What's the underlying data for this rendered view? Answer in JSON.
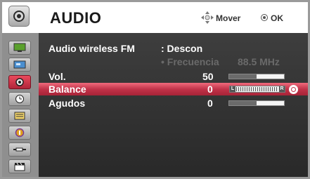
{
  "header": {
    "title": "AUDIO",
    "move_hint": "Mover",
    "ok_hint": "OK",
    "header_icon": "speaker-icon"
  },
  "sidebar": {
    "items": [
      {
        "icon": "picture-icon"
      },
      {
        "icon": "screen-icon"
      },
      {
        "icon": "audio-icon",
        "active": true
      },
      {
        "icon": "clock-icon"
      },
      {
        "icon": "options-icon"
      },
      {
        "icon": "info-icon"
      },
      {
        "icon": "input-icon"
      },
      {
        "icon": "clapper-icon"
      }
    ]
  },
  "menu": {
    "wireless_label": "Audio wireless FM",
    "wireless_value": ": Descon",
    "frequency_label": "• Frecuencia",
    "frequency_value": "88.5 MHz",
    "volume_label": "Vol.",
    "volume_value": "50",
    "volume_level": 0.5,
    "balance_label": "Balance",
    "balance_value": "0",
    "balance_left": "L",
    "balance_right": "R",
    "treble_label": "Agudos",
    "treble_value": "0",
    "treble_level": 0.5
  },
  "colors": {
    "highlight": "#c13349",
    "panel": "#333333",
    "sidebar": "#8f8f8f"
  }
}
